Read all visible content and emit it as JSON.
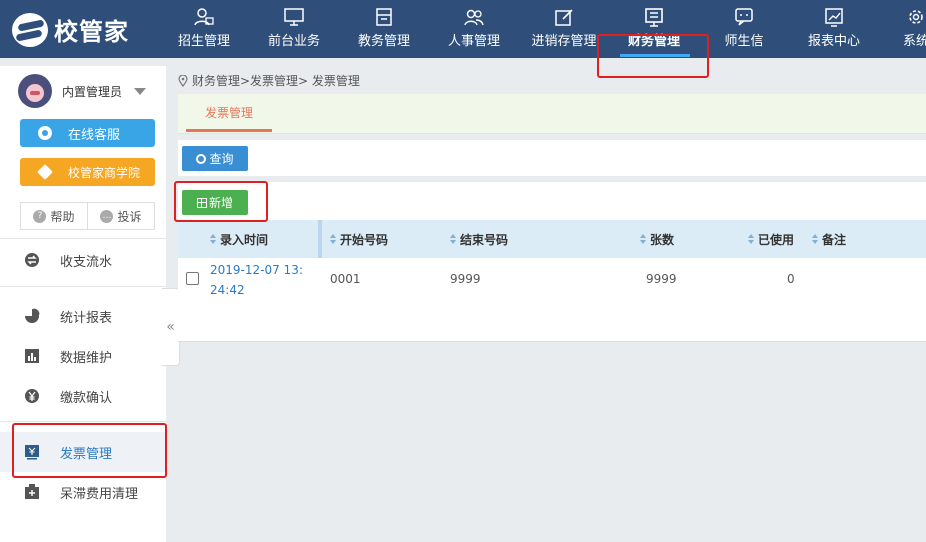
{
  "app": {
    "logo_text": "校管家"
  },
  "nav": {
    "items": [
      {
        "label": "招生管理",
        "icon": "user-card-icon"
      },
      {
        "label": "前台业务",
        "icon": "monitor-icon"
      },
      {
        "label": "教务管理",
        "icon": "box-icon"
      },
      {
        "label": "人事管理",
        "icon": "people-icon"
      },
      {
        "label": "进销存管理",
        "icon": "edit-icon"
      },
      {
        "label": "财务管理",
        "icon": "finance-icon",
        "active": true
      },
      {
        "label": "师生信",
        "icon": "chat-icon"
      },
      {
        "label": "报表中心",
        "icon": "chart-icon"
      },
      {
        "label": "系统",
        "icon": "gear-icon"
      }
    ]
  },
  "sidebar": {
    "user_name": "内置管理员",
    "service_label": "在线客服",
    "academy_label": "校管家商学院",
    "help_label": "帮助",
    "complain_label": "投诉",
    "menu": [
      {
        "label": "收支流水",
        "icon": "exchange-icon"
      },
      {
        "label": "统计报表",
        "icon": "pie-chart-icon"
      },
      {
        "label": "数据维护",
        "icon": "bar-chart-icon"
      },
      {
        "label": "缴款确认",
        "icon": "yen-icon"
      },
      {
        "label": "发票管理",
        "icon": "invoice-icon",
        "active": true
      },
      {
        "label": "呆滞费用清理",
        "icon": "cleanup-icon"
      }
    ],
    "collapse_glyph": "«"
  },
  "breadcrumb": "财务管理>发票管理> 发票管理",
  "tabs": {
    "active_label": "发票管理"
  },
  "toolbar": {
    "query_label": "查询",
    "add_label": "新增"
  },
  "table": {
    "columns": [
      "录入时间",
      "开始号码",
      "结束号码",
      "张数",
      "已使用",
      "备注"
    ],
    "rows": [
      {
        "entry_time": "2019-12-07 13:24:42",
        "start_no": "0001",
        "end_no": "9999",
        "count": "9999",
        "used": "0",
        "note": ""
      }
    ]
  },
  "colors": {
    "nav_bg": "#2f4f7a",
    "accent": "#3aa5e6",
    "tab_accent": "#e8755a",
    "add_green": "#4caf50",
    "highlight_red": "#e02020"
  }
}
